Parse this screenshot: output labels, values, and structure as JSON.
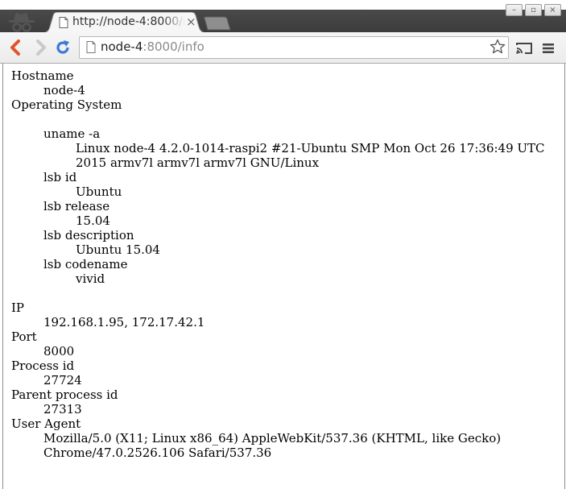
{
  "tab": {
    "title": "http://node-4:8000/info",
    "close": "×"
  },
  "window_controls": [
    "–",
    "▫",
    "×"
  ],
  "address_bar": {
    "host": "node-4",
    "rest": ":8000/info"
  },
  "icons": {
    "incognito": "incognito-icon",
    "back": "back-arrow-icon",
    "forward": "forward-arrow-icon",
    "reload": "reload-icon",
    "page": "page-icon",
    "star": "star-icon",
    "cast": "cast-icon",
    "menu": "hamburger-menu-icon"
  },
  "colors": {
    "nav_back": "#e0532b",
    "reload": "#3b7bd6",
    "titlebar": "#3c3c3c"
  },
  "info": {
    "hostname": {
      "label": "Hostname",
      "value": "node-4"
    },
    "os": {
      "label": "Operating System",
      "uname": {
        "label": "uname -a",
        "value": "Linux node-4 4.2.0-1014-raspi2 #21-Ubuntu SMP Mon Oct 26 17:36:49 UTC 2015 armv7l armv7l armv7l GNU/Linux"
      },
      "lsb_id": {
        "label": "lsb id",
        "value": "Ubuntu"
      },
      "lsb_release": {
        "label": "lsb release",
        "value": "15.04"
      },
      "lsb_description": {
        "label": "lsb description",
        "value": "Ubuntu 15.04"
      },
      "lsb_codename": {
        "label": "lsb codename",
        "value": "vivid"
      }
    },
    "ip": {
      "label": "IP",
      "value": "192.168.1.95, 172.17.42.1"
    },
    "port": {
      "label": "Port",
      "value": "8000"
    },
    "pid": {
      "label": "Process id",
      "value": "27724"
    },
    "ppid": {
      "label": "Parent process id",
      "value": "27313"
    },
    "user_agent": {
      "label": "User Agent",
      "value": "Mozilla/5.0 (X11; Linux x86_64) AppleWebKit/537.36 (KHTML, like Gecko) Chrome/47.0.2526.106 Safari/537.36"
    }
  }
}
